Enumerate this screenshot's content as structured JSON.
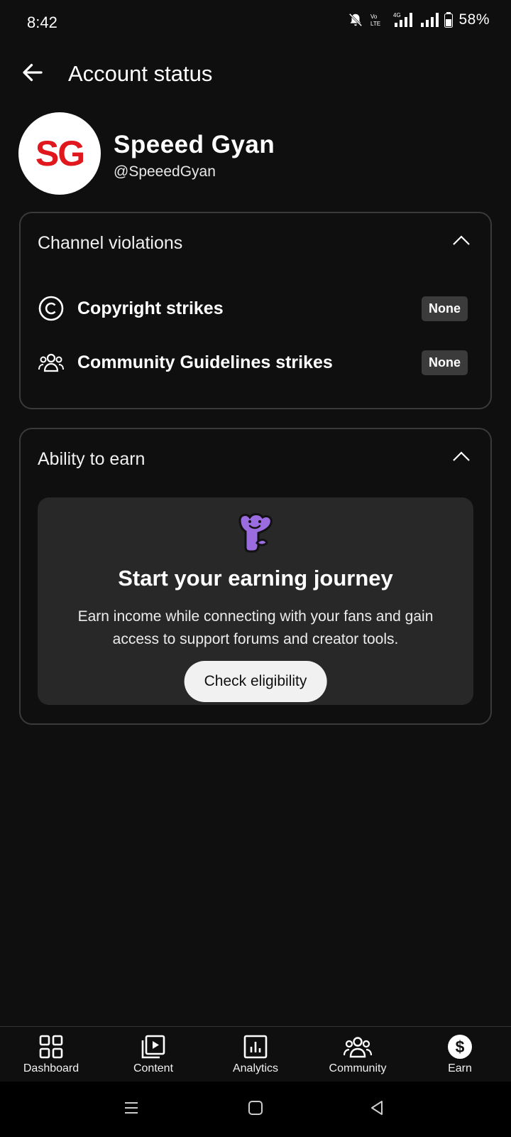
{
  "status_bar": {
    "time": "8:42",
    "battery": "58%"
  },
  "app_bar": {
    "title": "Account status"
  },
  "channel": {
    "initials": "SG",
    "name": "Speeed Gyan",
    "handle": "@SpeeedGyan"
  },
  "violations": {
    "title": "Channel violations",
    "rows": [
      {
        "label": "Copyright strikes",
        "value": "None"
      },
      {
        "label": "Community Guidelines strikes",
        "value": "None"
      }
    ]
  },
  "earn": {
    "title": "Ability to earn",
    "headline": "Start your earning journey",
    "description": "Earn income while connecting with your fans and gain access to support forums and creator tools.",
    "button": "Check eligibility"
  },
  "bottom_nav": [
    {
      "label": "Dashboard",
      "icon": "dashboard-icon"
    },
    {
      "label": "Content",
      "icon": "content-icon"
    },
    {
      "label": "Analytics",
      "icon": "analytics-icon"
    },
    {
      "label": "Community",
      "icon": "community-icon"
    },
    {
      "label": "Earn",
      "icon": "earn-icon"
    }
  ],
  "colors": {
    "background": "#0f0f0f",
    "brand_red": "#e1171e",
    "mascot": "#9b6ce0"
  }
}
